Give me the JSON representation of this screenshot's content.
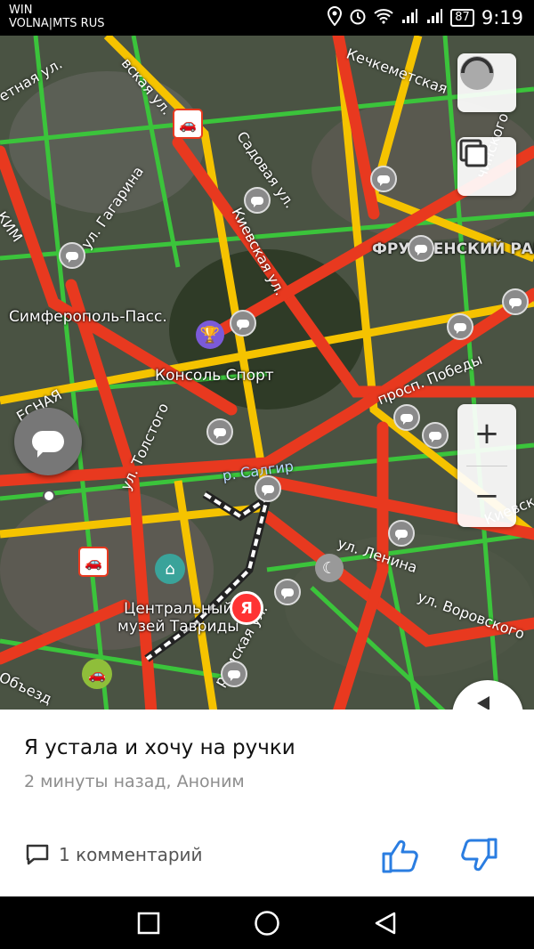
{
  "status_bar": {
    "carrier_line1": "WIN",
    "carrier_line2": "VOLNA|MTS RUS",
    "battery": "87",
    "time": "9:19",
    "icons": [
      "location-icon",
      "alarm-icon",
      "wifi-icon",
      "signal-icon",
      "signal-icon-2",
      "battery-icon"
    ]
  },
  "map": {
    "places": {
      "station": "Симферополь-Пасс.",
      "sport": "Консоль Спорт",
      "museum_line1": "Центральный",
      "museum_line2": "музей Тавриды",
      "district": "ФРУНЗЕНСКИЙ РАЙ"
    },
    "streets": {
      "gagarina": "ул. Гагарина",
      "sadovaya": "Садовая ул.",
      "kievskaya": "Киевская ул.",
      "tolstogo": "ул. Толстого",
      "pobedy": "просп. Победы",
      "lenina": "ул. Ленина",
      "vorovskogo": "ул. Воровского",
      "salgir": "р. Салгир",
      "kechkemetskaya": "Кечкеметская",
      "vskaya": "вская ул.",
      "kievskaya_right": "Киевск",
      "krymskaya": "рымская ул.",
      "obezd": "Объезд",
      "lesnaya": "ЕСНАЯ",
      "kim": "КИМ",
      "chinskogo": "чинского",
      "vetnaya": "етная ул."
    },
    "yandex_marker": "Я"
  },
  "controls": {
    "zoom_in": "+",
    "zoom_out": "−"
  },
  "event": {
    "title": "Я устала и хочу на ручки",
    "meta": "2 минуты назад, Аноним",
    "comments": "1 комментарий"
  },
  "colors": {
    "jam": "#e8391f",
    "slow": "#f5c300",
    "free": "#3bc43b",
    "accent_blue": "#2a7de1",
    "yandex_red": "#f33"
  }
}
